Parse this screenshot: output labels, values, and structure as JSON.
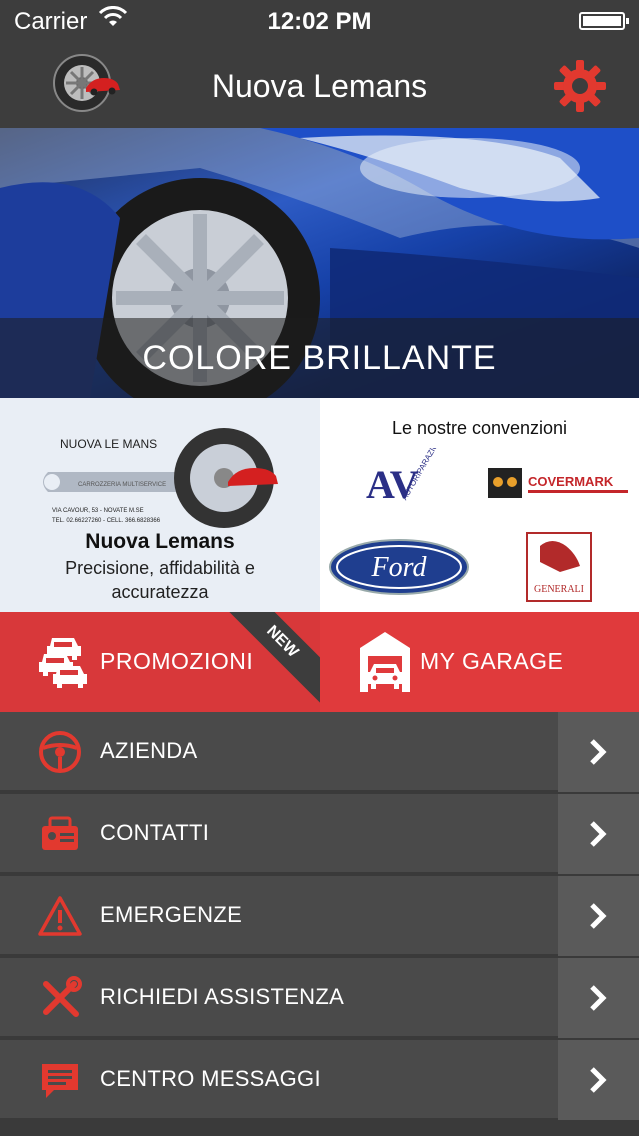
{
  "status_bar": {
    "carrier": "Carrier",
    "time": "12:02 PM"
  },
  "nav": {
    "title": "Nuova Lemans",
    "logo_icon": "wheel-car-logo",
    "settings_icon": "gear-icon"
  },
  "hero": {
    "caption": "COLORE BRILLANTE"
  },
  "company": {
    "logo_top": "NUOVA LE MANS",
    "logo_sub": "CARROZZERIA MULTISERVICE",
    "logo_addr1": "VIA CAVOUR, 53 - NOVATE M.SE",
    "logo_addr2": "TEL. 02.66227260 - CELL. 366.6828366",
    "name": "Nuova Lemans",
    "tagline": "Precisione, affidabilità e accuratezza"
  },
  "conventions": {
    "title": "Le nostre convenzioni",
    "partners": [
      "AUTORIPARAZIONI VALIDO",
      "COVERMARK",
      "Ford",
      "GENERALI"
    ]
  },
  "actions": {
    "promo": {
      "label": "PROMOZIONI",
      "badge": "NEW"
    },
    "garage": {
      "label": "MY GARAGE"
    }
  },
  "menu": [
    {
      "label": "AZIENDA",
      "icon": "steering-wheel-icon"
    },
    {
      "label": "CONTATTI",
      "icon": "contact-card-icon"
    },
    {
      "label": "EMERGENZE",
      "icon": "warning-icon"
    },
    {
      "label": "RICHIEDI ASSISTENZA",
      "icon": "tools-icon"
    },
    {
      "label": "CENTRO MESSAGGI",
      "icon": "message-icon"
    }
  ],
  "colors": {
    "accent": "#e03a3c",
    "dark": "#3d3d3d",
    "menu_bg": "#4a4a4a"
  }
}
